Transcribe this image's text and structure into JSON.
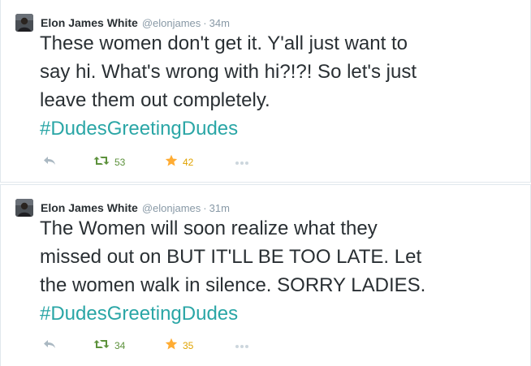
{
  "colors": {
    "text": "#292f33",
    "muted": "#8899a6",
    "hashtag": "#2aa6a6",
    "retweet": "#5c913b",
    "favorite": "#ffac33",
    "favorite_count": "#e0a300"
  },
  "tweets": [
    {
      "author": "Elon James White",
      "handle": "@elonjames",
      "separator": "·",
      "time": "34m",
      "text_lines": [
        "These women don't get it. Y'all just want to",
        "say hi. What's wrong with hi?!?! So let's just",
        "leave them out completely."
      ],
      "hashtag": "#DudesGreetingDudes",
      "retweets": "53",
      "favorites": "42",
      "icons": [
        "avatar",
        "reply-icon",
        "retweet-icon",
        "star-icon",
        "more-icon"
      ]
    },
    {
      "author": "Elon James White",
      "handle": "@elonjames",
      "separator": "·",
      "time": "31m",
      "text_lines": [
        "The Women will soon realize what they",
        "missed out on BUT IT'LL BE TOO LATE. Let",
        "the women walk in silence. SORRY LADIES."
      ],
      "hashtag": "#DudesGreetingDudes",
      "retweets": "34",
      "favorites": "35",
      "icons": [
        "avatar",
        "reply-icon",
        "retweet-icon",
        "star-icon",
        "more-icon"
      ]
    }
  ]
}
